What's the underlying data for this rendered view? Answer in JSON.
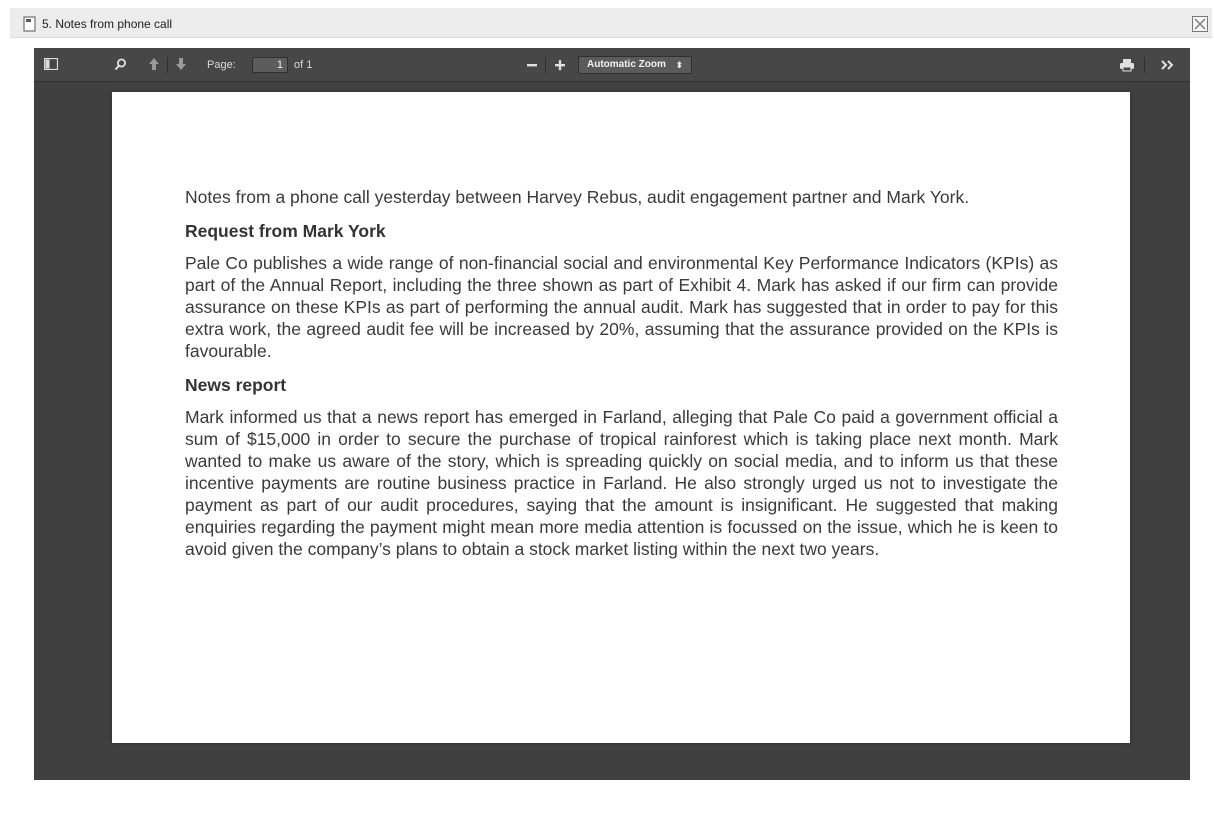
{
  "window": {
    "title": "5. Notes from phone call"
  },
  "toolbar": {
    "page_label": "Page:",
    "page_value": "1",
    "page_total": "of 1",
    "zoom_value": "Automatic Zoom",
    "icons": {
      "sidebar": "sidebar-toggle-icon",
      "search": "search-icon",
      "prev": "arrow-up-icon",
      "next": "arrow-down-icon",
      "zoom_out": "minus-icon",
      "zoom_in": "plus-icon",
      "print": "print-icon",
      "tools": "double-chevron-right-icon"
    }
  },
  "document": {
    "intro": "Notes from a phone call yesterday between Harvey Rebus, audit engagement partner and Mark York.",
    "section1_heading": "Request from Mark York",
    "section1_body": "Pale Co publishes a wide range of non-financial social and environmental Key Performance Indicators (KPIs) as part of the Annual Report, including the three shown as part of Exhibit 4. Mark has asked if our firm can provide assurance on these KPIs as part of performing the annual audit. Mark has suggested that in order to pay for this extra work, the agreed audit fee will be increased by 20%, assuming that the assurance provided on the KPIs is favourable.",
    "section2_heading": "News report",
    "section2_body": "Mark informed us that a news report has emerged in Farland, alleging that Pale Co paid a government official a sum of $15,000 in order to secure the purchase of tropical rainforest which is taking place next month. Mark wanted to make us aware of the story, which is spreading quickly on social media, and to inform us that these incentive payments are routine business practice in Farland. He also strongly urged us not to investigate the payment as part of our audit procedures, saying that the amount is insignificant. He suggested that making enquiries regarding the payment might mean more media attention is focussed on the issue, which he is keen to avoid given the company’s plans to obtain a stock market listing within the next two years."
  },
  "colors": {
    "viewer_bg": "#404040",
    "toolbar_bg": "#474747",
    "page_bg": "#ffffff",
    "text": "#3a3a3a"
  }
}
